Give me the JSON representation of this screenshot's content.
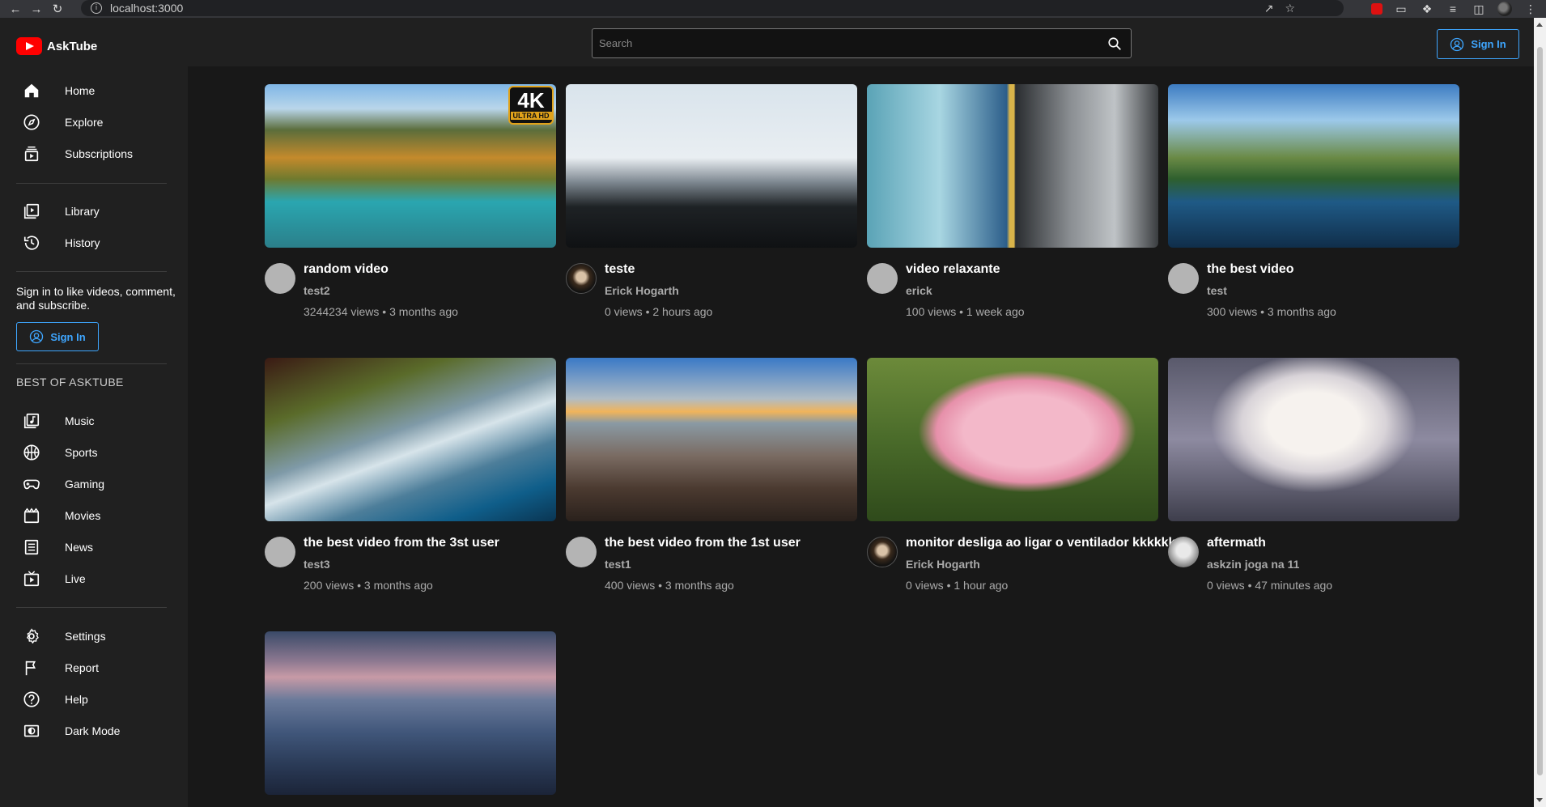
{
  "browser": {
    "url": "localhost:3000"
  },
  "app": {
    "name": "AskTube",
    "search_placeholder": "Search",
    "sign_in_label": "Sign In"
  },
  "sidebar": {
    "main": [
      {
        "label": "Home",
        "icon": "home-icon"
      },
      {
        "label": "Explore",
        "icon": "compass-icon"
      },
      {
        "label": "Subscriptions",
        "icon": "subscriptions-icon"
      }
    ],
    "library": [
      {
        "label": "Library",
        "icon": "library-icon"
      },
      {
        "label": "History",
        "icon": "history-icon"
      }
    ],
    "signin_prompt": "Sign in to like videos, comment, and subscribe.",
    "signin_label": "Sign In",
    "section_title": "BEST OF ASKTUBE",
    "best": [
      {
        "label": "Music",
        "icon": "music-icon"
      },
      {
        "label": "Sports",
        "icon": "sports-icon"
      },
      {
        "label": "Gaming",
        "icon": "gaming-icon"
      },
      {
        "label": "Movies",
        "icon": "movies-icon"
      },
      {
        "label": "News",
        "icon": "news-icon"
      },
      {
        "label": "Live",
        "icon": "live-icon"
      }
    ],
    "bottom": [
      {
        "label": "Settings",
        "icon": "settings-icon"
      },
      {
        "label": "Report",
        "icon": "flag-icon"
      },
      {
        "label": "Help",
        "icon": "help-icon"
      },
      {
        "label": "Dark Mode",
        "icon": "dark-mode-icon"
      }
    ]
  },
  "videos": [
    {
      "title": "random video",
      "channel": "test2",
      "meta": "3244234 views • 3 months ago",
      "thumb": "mountain-lake-4k",
      "badge_big": "4K",
      "badge_small": "ULTRA HD"
    },
    {
      "title": "teste",
      "channel": "Erick Hogarth",
      "meta": "0 views • 2 hours ago",
      "thumb": "plane-wreck"
    },
    {
      "title": "video relaxante",
      "channel": "erick",
      "meta": "100 views • 1 week ago",
      "thumb": "ice-bucket"
    },
    {
      "title": "the best video",
      "channel": "test",
      "meta": "300 views • 3 months ago",
      "thumb": "lake-valley"
    },
    {
      "title": "the best video from the 3st user",
      "channel": "test3",
      "meta": "200 views • 3 months ago",
      "thumb": "cave-lagoon"
    },
    {
      "title": "the best video from the 1st user",
      "channel": "test1",
      "meta": "400 views • 3 months ago",
      "thumb": "sunset-clouds"
    },
    {
      "title": "monitor desliga ao ligar o ventilador kkkkkk",
      "channel": "Erick Hogarth",
      "meta": "0 views • 1 hour ago",
      "thumb": "axolotl"
    },
    {
      "title": "aftermath",
      "channel": "askzin joga na 11",
      "meta": "0 views • 47 minutes ago",
      "thumb": "anime"
    },
    {
      "title": "",
      "channel": "",
      "meta": "",
      "thumb": "misty-mountains"
    }
  ]
}
